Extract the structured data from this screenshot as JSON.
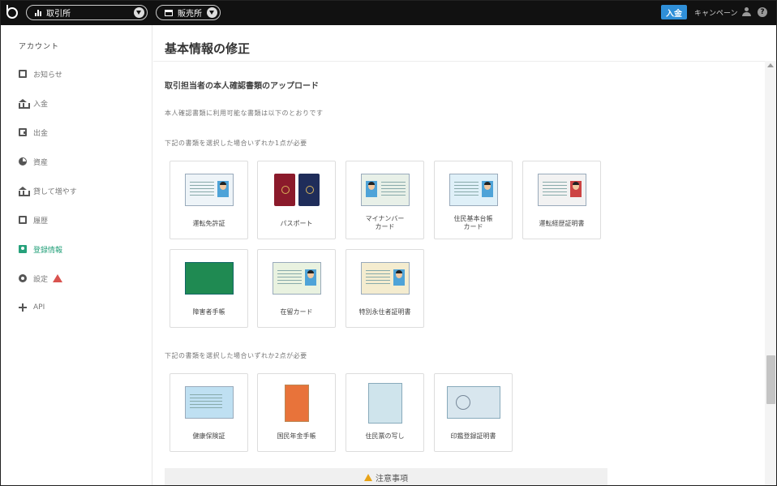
{
  "topbar": {
    "exchange_label": "取引所",
    "store_label": "販売所",
    "deposit_button": "入金",
    "campaign_link": "キャンペーン",
    "help_glyph": "?"
  },
  "sidebar": {
    "heading": "アカウント",
    "items": [
      {
        "label": "お知らせ",
        "icon": "chat-icon"
      },
      {
        "label": "入金",
        "icon": "bank-icon"
      },
      {
        "label": "出金",
        "icon": "wallet-icon"
      },
      {
        "label": "資産",
        "icon": "pie-chart-icon"
      },
      {
        "label": "貸して増やす",
        "icon": "bank-icon"
      },
      {
        "label": "履歴",
        "icon": "document-icon"
      },
      {
        "label": "登録情報",
        "icon": "id-card-icon",
        "active": true
      },
      {
        "label": "設定",
        "icon": "gear-icon",
        "warning": true
      },
      {
        "label": "API",
        "icon": "move-icon"
      }
    ]
  },
  "main": {
    "page_title": "基本情報の修正",
    "section_title": "取引担当者の本人確認書類のアップロード",
    "intro_note": "本人確認書類に利用可能な書類は以下のとおりです",
    "group1_note": "下記の書類を選択した場合いずれか1点が必要",
    "group2_note": "下記の書類を選択した場合いずれか2点が必要",
    "group1_docs": [
      {
        "label": "運転免許証"
      },
      {
        "label": "パスポート"
      },
      {
        "label": "マイナンバー\nカード"
      },
      {
        "label": "住民基本台帳\nカード"
      },
      {
        "label": "運転経歴証明書"
      },
      {
        "label": "障害者手帳"
      },
      {
        "label": "在留カード"
      },
      {
        "label": "特別永住者証明書"
      }
    ],
    "group2_docs": [
      {
        "label": "健康保険証"
      },
      {
        "label": "国民年金手帳"
      },
      {
        "label": "住民票の写し"
      },
      {
        "label": "印鑑登録証明書"
      }
    ],
    "caution_label": "注意事項"
  },
  "colors": {
    "active_green": "#26a17b",
    "deposit_blue": "#2f8fd8",
    "warning_red": "#d9534f",
    "caution_amber": "#e8a317"
  }
}
